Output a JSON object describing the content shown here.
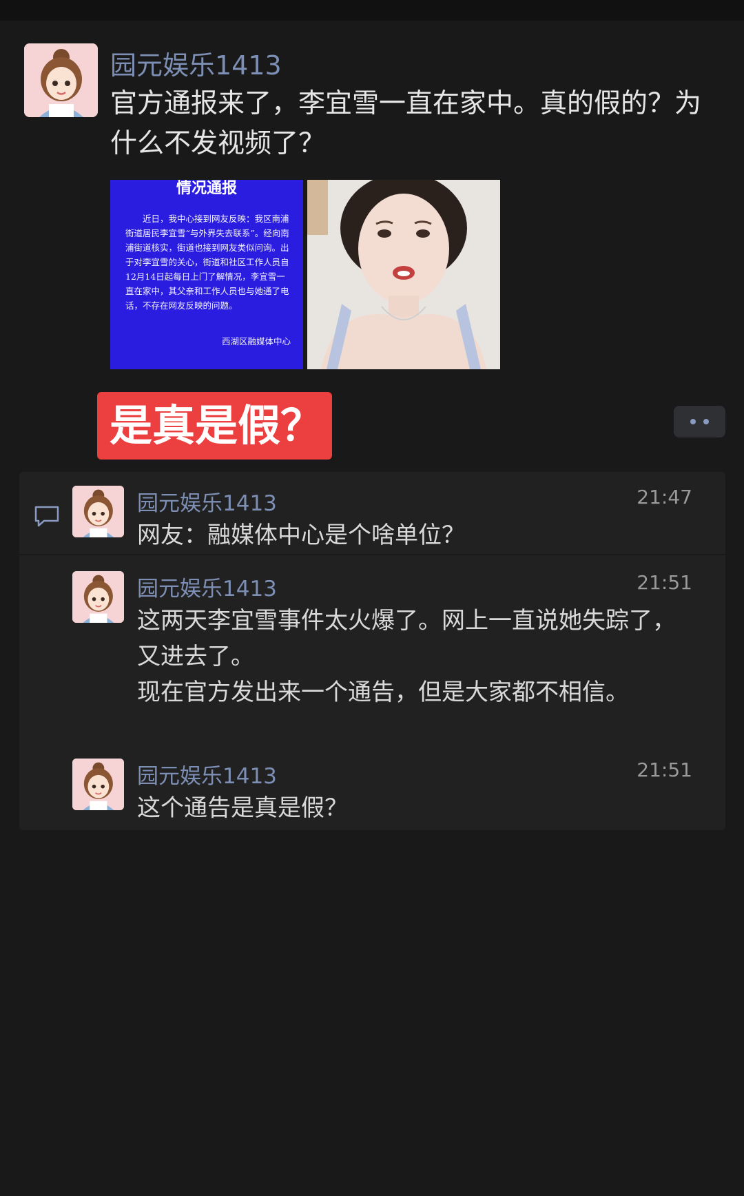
{
  "post": {
    "author": "园元娱乐1413",
    "text": "官方通报来了，李宜雪一直在家中。真的假的？为什么不发视频了？",
    "image_notice": {
      "title": "情况通报",
      "body": "近日，我中心接到网友反映：我区南浦街道居民李宜雪“与外界失去联系”。经向南浦街道核实，街道也接到网友类似问询。出于对李宜雪的关心，街道和社区工作人员自12月14日起每日上门了解情况，李宜雪一直在家中，其父亲和工作人员也与她通了电话，不存在网友反映的问题。",
      "footer": "西湖区融媒体中心"
    },
    "tag_text": "是真是假？"
  },
  "comments": [
    {
      "author": "园元娱乐1413",
      "time": "21:47",
      "lines": [
        "网友：融媒体中心是个啥单位？"
      ]
    },
    {
      "author": "园元娱乐1413",
      "time": "21:51",
      "lines": [
        "这两天李宜雪事件太火爆了。网上一直说她失踪了，",
        "又进去了。",
        "现在官方发出来一个通告，但是大家都不相信。"
      ]
    },
    {
      "author": "园元娱乐1413",
      "time": "21:51",
      "lines": [
        "这个通告是真是假？"
      ]
    }
  ],
  "icons": {
    "comment": "comment-bubble-icon",
    "more": "more-dots-icon"
  },
  "colors": {
    "background": "#191919",
    "comment_panel": "#212121",
    "author_link": "#7d8fb4",
    "tag_red": "#ec3f3f",
    "notice_blue": "#2a1de0"
  }
}
